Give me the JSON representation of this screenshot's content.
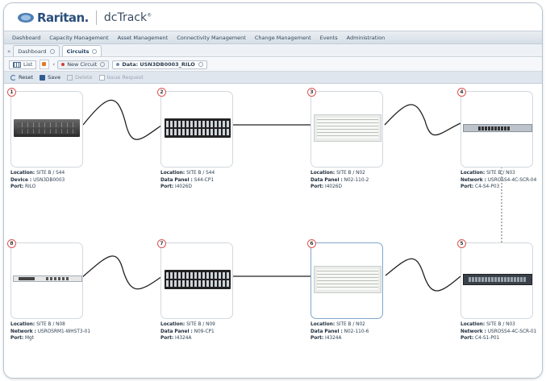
{
  "header": {
    "brand": "Raritan.",
    "product": "dcTrack",
    "trademark": "®"
  },
  "menu": [
    "Dashboard",
    "Capacity Management",
    "Asset Management",
    "Connectivity Management",
    "Change Management",
    "Events",
    "Administration"
  ],
  "tabs": [
    {
      "label": "Dashboard",
      "active": false
    },
    {
      "label": "Circuits",
      "active": true
    }
  ],
  "subtabs": {
    "list_label": "List",
    "new_circuit": "New Circuit",
    "data_prefix": "Data:",
    "data_value": "USN3DB0003_RILO"
  },
  "toolbar": {
    "reset": "Reset",
    "save": "Save",
    "delete": "Delete",
    "issue_request": "Issue Request"
  },
  "nodes": [
    {
      "num": "1",
      "device": "server",
      "lines": [
        {
          "label": "Location:",
          "value": "SITE B / S44"
        },
        {
          "label": "Device :",
          "value": "USN3DB0003"
        },
        {
          "label": "Port:",
          "value": "RILO"
        }
      ]
    },
    {
      "num": "2",
      "device": "panel",
      "lines": [
        {
          "label": "Location:",
          "value": "SITE B / S44"
        },
        {
          "label": "Data Panel :",
          "value": "S44-CP1"
        },
        {
          "label": "Port:",
          "value": "I4026D"
        }
      ]
    },
    {
      "num": "3",
      "device": "patch",
      "lines": [
        {
          "label": "Location:",
          "value": "SITE B / N02"
        },
        {
          "label": "Data Panel :",
          "value": "N02-110-2"
        },
        {
          "label": "Port:",
          "value": "I4026D"
        }
      ]
    },
    {
      "num": "4",
      "device": "switch",
      "lines": [
        {
          "label": "Location:",
          "value": "SITE B / N03"
        },
        {
          "label": "Network :",
          "value": "USROSS4-4C-SCR-04"
        },
        {
          "label": "Port:",
          "value": "C4-S4-P03"
        }
      ]
    },
    {
      "num": "8",
      "device": "router",
      "lines": [
        {
          "label": "Location:",
          "value": "SITE B / N08"
        },
        {
          "label": "Network :",
          "value": "USROSRM1-WHST3-01"
        },
        {
          "label": "Port:",
          "value": "Mgt"
        }
      ]
    },
    {
      "num": "7",
      "device": "panel",
      "lines": [
        {
          "label": "Location:",
          "value": "SITE B / N09"
        },
        {
          "label": "Data Panel :",
          "value": "N09-CP1"
        },
        {
          "label": "Port:",
          "value": "I4324A"
        }
      ]
    },
    {
      "num": "6",
      "device": "patch",
      "selected": true,
      "lines": [
        {
          "label": "Location:",
          "value": "SITE B / N02"
        },
        {
          "label": "Data Panel :",
          "value": "N02-110-6"
        },
        {
          "label": "Port:",
          "value": "I4324A"
        }
      ]
    },
    {
      "num": "5",
      "device": "switch2",
      "lines": [
        {
          "label": "Location:",
          "value": "SITE B / N03"
        },
        {
          "label": "Network :",
          "value": "USROSS4-4C-SCR-01"
        },
        {
          "label": "Port:",
          "value": "C4-S1-P01"
        }
      ]
    }
  ],
  "colors": {
    "accent": "#2a4f7c",
    "badge_border": "#dd5555",
    "selected_border": "#7fa6cc"
  }
}
